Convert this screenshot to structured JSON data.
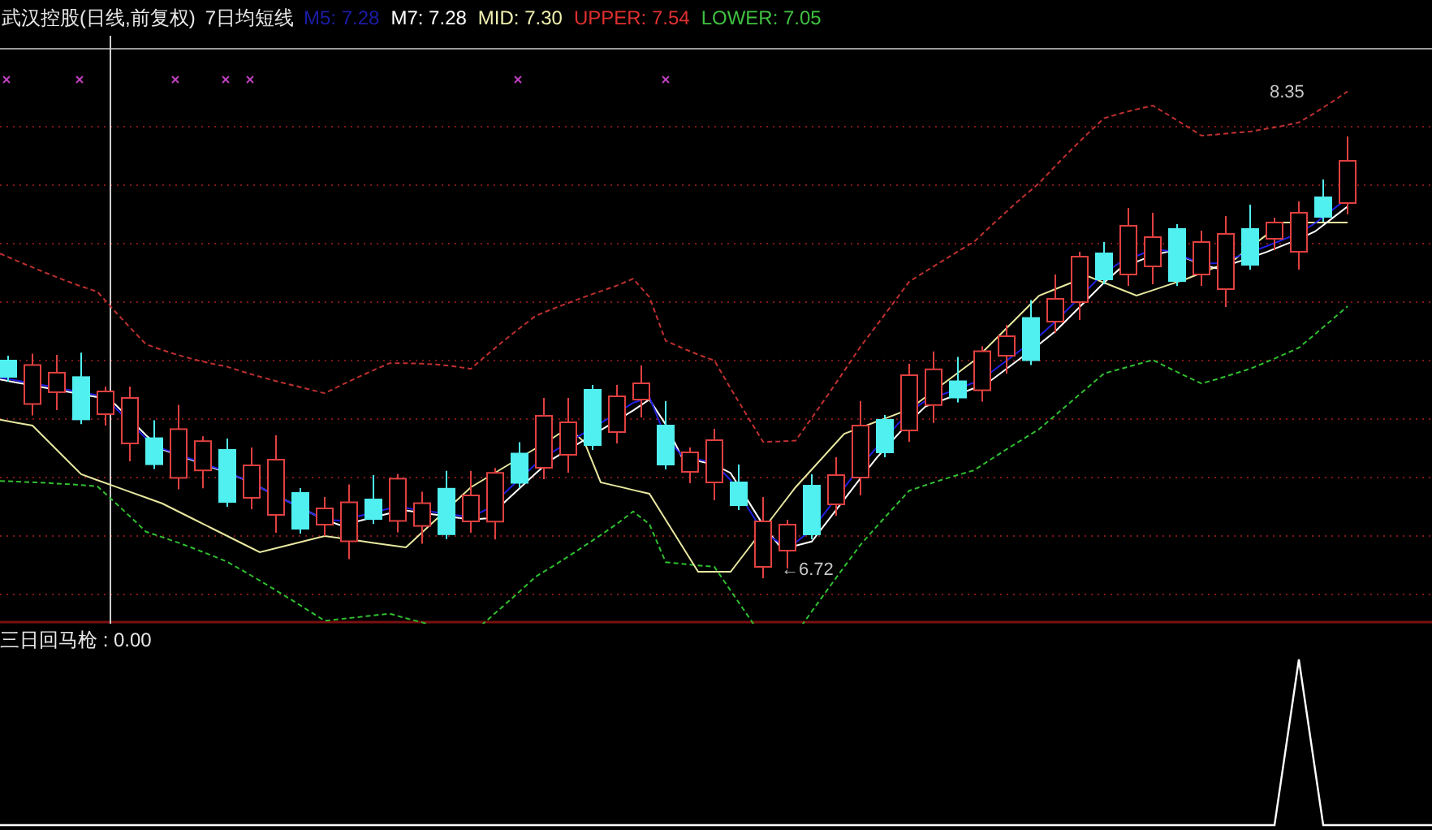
{
  "header": {
    "title": "武汉控股(日线,前复权)",
    "indicator": "7日均短线",
    "values": [
      {
        "label": "M5: 7.28",
        "color": "#1c1ca8"
      },
      {
        "label": "M7: 7.28",
        "color": "#ffffff"
      },
      {
        "label": "MID: 7.30",
        "color": "#f0f0b0"
      },
      {
        "label": "UPPER: 7.54",
        "color": "#e03030"
      },
      {
        "label": "LOWER: 7.05",
        "color": "#40c040"
      }
    ]
  },
  "main_chart": {
    "high_label": "8.35",
    "low_label": "←6.72"
  },
  "sub_chart": {
    "label": "三日回马枪 : 0.00"
  }
}
